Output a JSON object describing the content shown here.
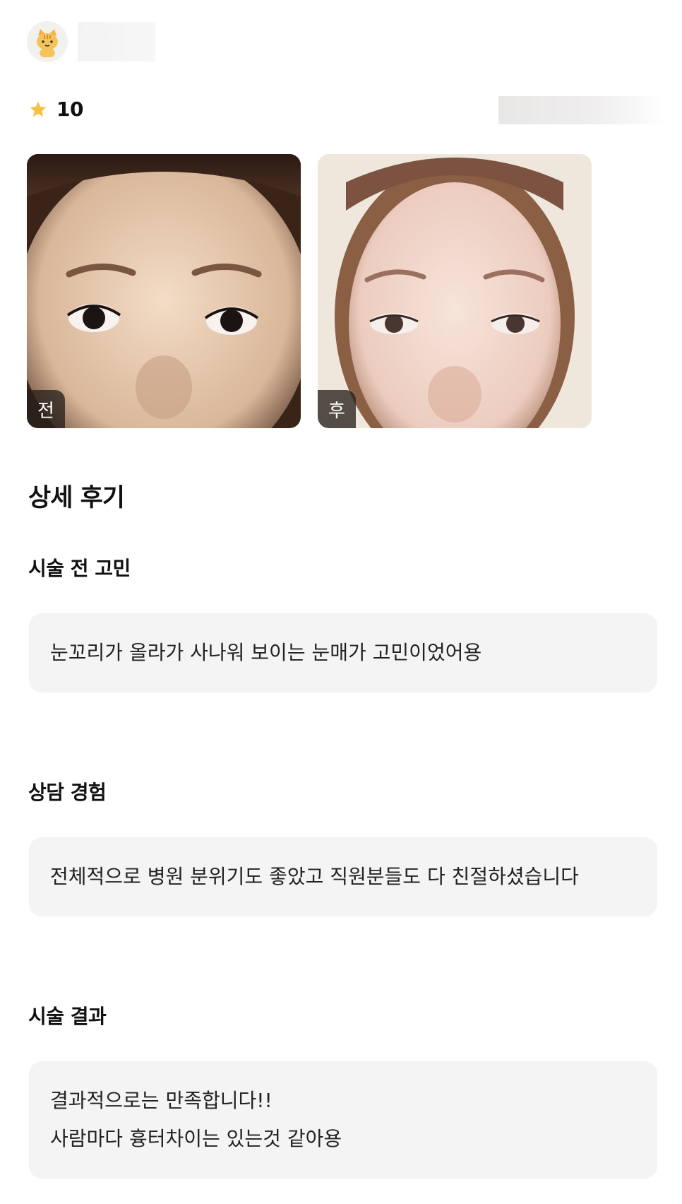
{
  "header": {
    "avatar_icon": "cat-avatar-icon"
  },
  "rating": {
    "icon": "star-icon",
    "value": "10",
    "star_color": "#f6c244"
  },
  "photos": [
    {
      "tag": "전"
    },
    {
      "tag": "후"
    }
  ],
  "review": {
    "title": "상세 후기",
    "sections": [
      {
        "heading": "시술 전 고민",
        "lines": [
          "눈꼬리가 올라가 사나워 보이는 눈매가 고민이었어용"
        ]
      },
      {
        "heading": "상담 경험",
        "lines": [
          "전체적으로 병원 분위기도 좋았고 직원분들도 다 친절하셨습니다"
        ]
      },
      {
        "heading": "시술 결과",
        "lines": [
          "결과적으로는 만족합니다!!",
          "사람마다 흉터차이는 있는것 같아용"
        ]
      }
    ]
  }
}
